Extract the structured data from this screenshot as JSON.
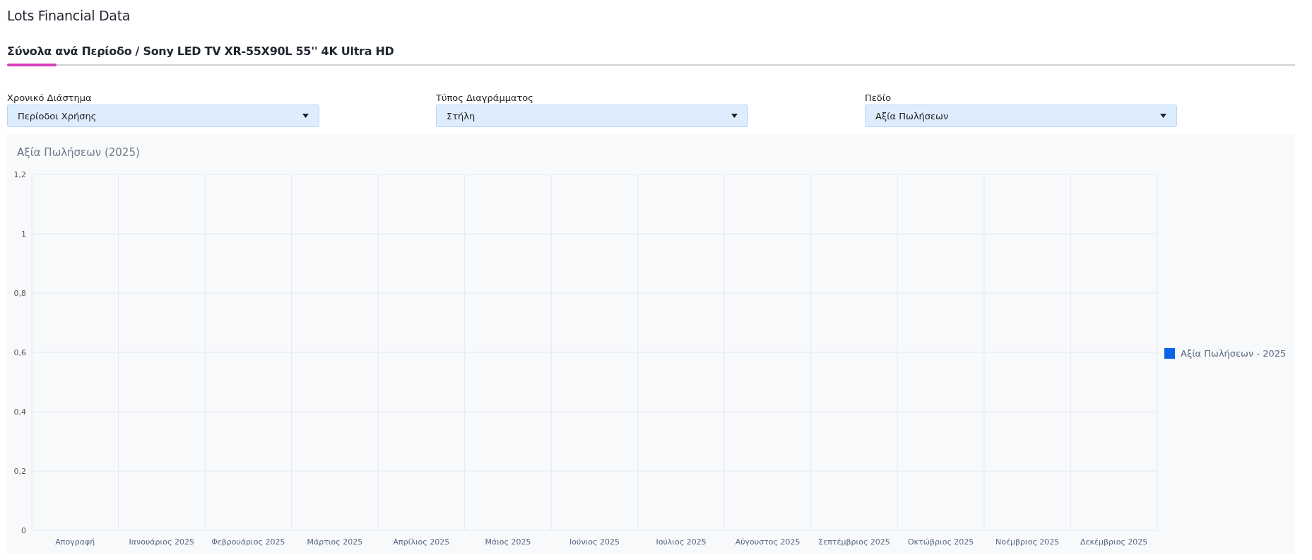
{
  "page": {
    "title": "Lots Financial Data"
  },
  "section": {
    "title": "Σύνολα ανά Περίοδο / Sony LED TV XR-55X90L 55'' 4K Ultra HD"
  },
  "filters": [
    {
      "label": "Χρονικό Διάστημα",
      "value": "Περίοδοι Χρήσης"
    },
    {
      "label": "Τύπος Διαγράμματος",
      "value": "Στήλη"
    },
    {
      "label": "Πεδίο",
      "value": "Αξία Πωλήσεων"
    }
  ],
  "chart": {
    "chart_data": {
      "type": "bar",
      "title": "Αξία Πωλήσεων (2025)",
      "categories": [
        "Απογραφή",
        "Ιανουάριος 2025",
        "Φεβρουάριος 2025",
        "Μάρτιος 2025",
        "Απρίλιος 2025",
        "Μάιος 2025",
        "Ιούνιος 2025",
        "Ιούλιος 2025",
        "Αύγουστος 2025",
        "Σεπτέμβριος 2025",
        "Οκτώβριος 2025",
        "Νοέμβριος 2025",
        "Δεκέμβριος 2025"
      ],
      "series": [
        {
          "name": "Αξία Πωλήσεων - 2025",
          "color": "#0b63e5",
          "values": [
            null,
            null,
            null,
            null,
            null,
            null,
            null,
            null,
            null,
            null,
            null,
            null,
            null
          ]
        }
      ],
      "ylim": [
        0,
        1.2
      ],
      "grid": true,
      "yticks": [
        {
          "value": 0,
          "label": "0"
        },
        {
          "value": 0.2,
          "label": "0,2"
        },
        {
          "value": 0.4,
          "label": "0,4"
        },
        {
          "value": 0.6,
          "label": "0,6"
        },
        {
          "value": 0.8,
          "label": "0,8"
        },
        {
          "value": 1,
          "label": "1"
        },
        {
          "value": 1.2,
          "label": "1,2"
        }
      ]
    }
  }
}
